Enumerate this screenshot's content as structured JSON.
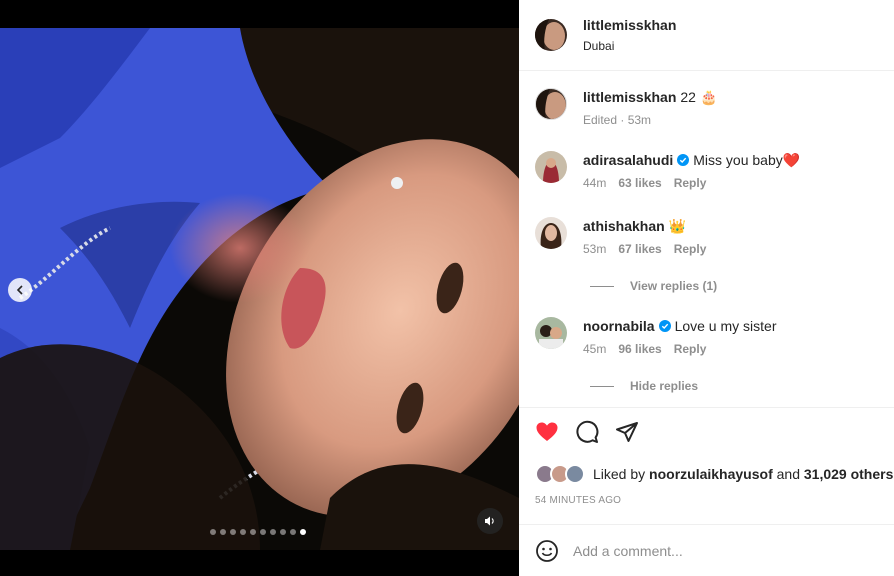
{
  "post": {
    "author": "littlemisskhan",
    "location": "Dubai",
    "caption_text": "22",
    "caption_emoji": "🎂",
    "caption_meta": "Edited · 53m"
  },
  "carousel": {
    "slide_count": 10,
    "active_index": 9,
    "prev_icon": "chevron-left-icon",
    "sound_icon": "speaker-icon"
  },
  "comments": [
    {
      "user": "adirasalahudi",
      "verified": true,
      "text": "Miss you baby❤️",
      "time": "44m",
      "likes": "63 likes",
      "reply": "Reply"
    },
    {
      "user": "athishakhan",
      "verified": false,
      "text": "👑",
      "time": "53m",
      "likes": "67 likes",
      "reply": "Reply"
    },
    {
      "user": "noornabila",
      "verified": true,
      "text": "Love u my sister",
      "time": "45m",
      "likes": "96 likes",
      "reply": "Reply"
    }
  ],
  "view_replies": "View replies (1)",
  "hide_replies": "Hide replies",
  "likes": {
    "prefix": "Liked by",
    "user": "noorzulaikhayusof",
    "and": "and",
    "others": "31,029 others"
  },
  "timestamp": "54 MINUTES AGO",
  "composer": {
    "placeholder": "Add a comment..."
  },
  "colors": {
    "like_red": "#ff3040",
    "verified_blue": "#0095f6",
    "muted": "#8e8e8e"
  }
}
